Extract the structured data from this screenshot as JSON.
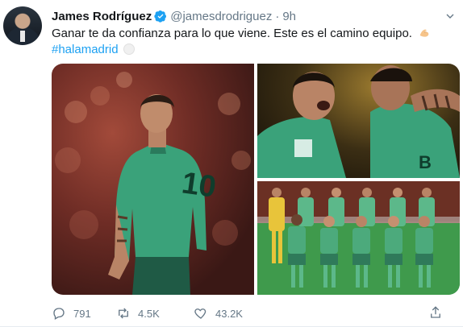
{
  "tweet": {
    "author_name": "James Rodríguez",
    "handle": "@jamesdrodriguez",
    "separator": "·",
    "time": "9h",
    "text": "Ganar te da confianza para lo que viene. Este es el camino equipo.",
    "text_emoji": "flexed-biceps-icon",
    "hashtag": "#halamadrid",
    "hashtag_emoji": "real-madrid-crest-icon"
  },
  "media": {
    "photos": [
      {
        "description_icon": "player-back-photo"
      },
      {
        "description_icon": "team-celebration-photo"
      },
      {
        "description_icon": "team-lineup-photo"
      }
    ]
  },
  "actions": {
    "reply_count": "791",
    "retweet_count": "4.5K",
    "like_count": "43.2K"
  },
  "colors": {
    "link": "#1da1f2",
    "secondary_text": "#657786",
    "verified": "#1da1f2"
  }
}
